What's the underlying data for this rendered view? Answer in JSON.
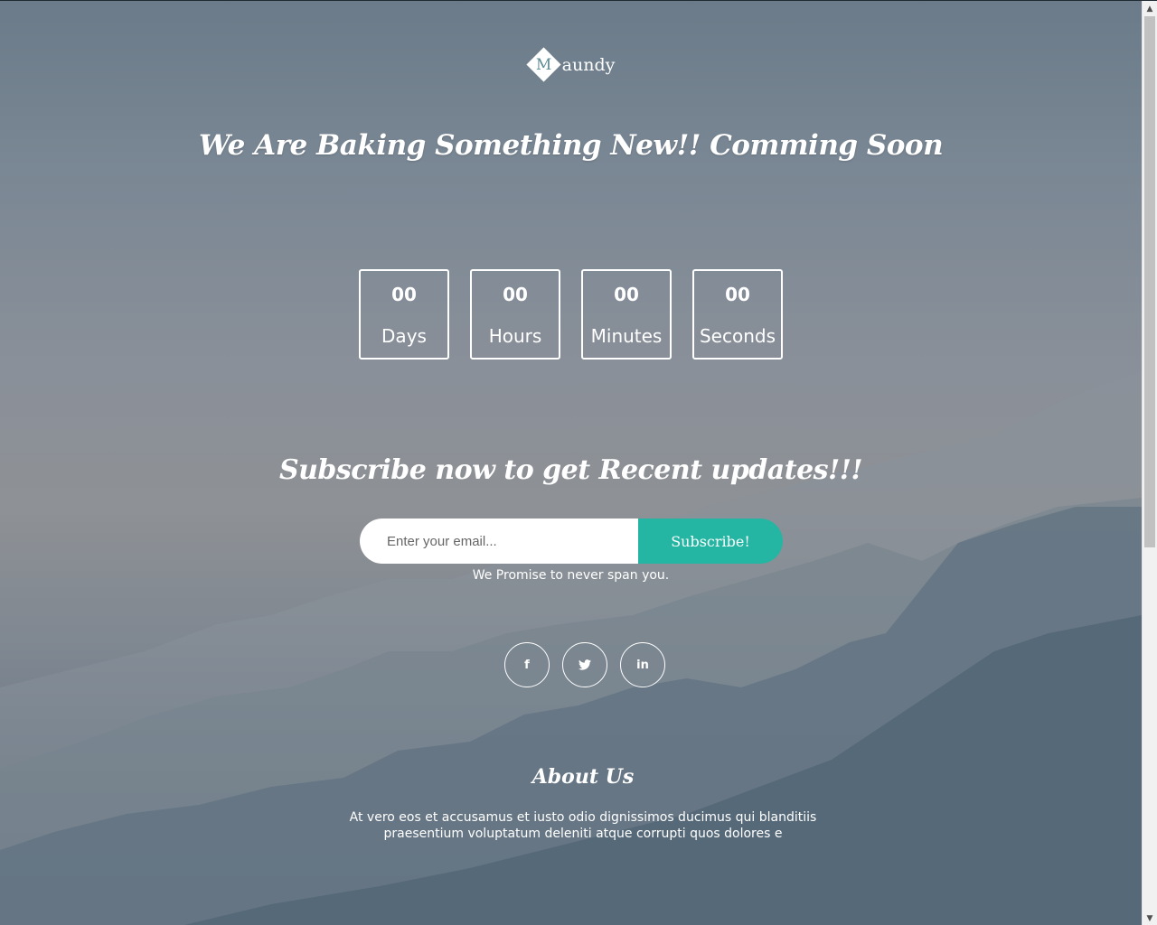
{
  "logo": {
    "letter": "M",
    "text": "aundy"
  },
  "hero": {
    "title": "We Are Baking Something New!! Comming Soon"
  },
  "countdown": [
    {
      "value": "00",
      "label": "Days"
    },
    {
      "value": "00",
      "label": "Hours"
    },
    {
      "value": "00",
      "label": "Minutes"
    },
    {
      "value": "00",
      "label": "Seconds"
    }
  ],
  "subscribe": {
    "heading": "Subscribe now to get Recent updates!!!",
    "placeholder": "Enter your email...",
    "button_label": "Subscribe!",
    "note": "We Promise to never span you."
  },
  "social": [
    {
      "icon": "facebook-icon",
      "glyph": "f"
    },
    {
      "icon": "twitter-icon",
      "glyph": "🐦"
    },
    {
      "icon": "linkedin-icon",
      "glyph": "in"
    }
  ],
  "about": {
    "heading": "About Us",
    "text": "At vero eos et accusamus et iusto odio dignissimos ducimus qui blanditiis praesentium voluptatum deleniti atque corrupti quos dolores e"
  },
  "colors": {
    "accent": "#24b6a3",
    "text": "#ffffff"
  }
}
